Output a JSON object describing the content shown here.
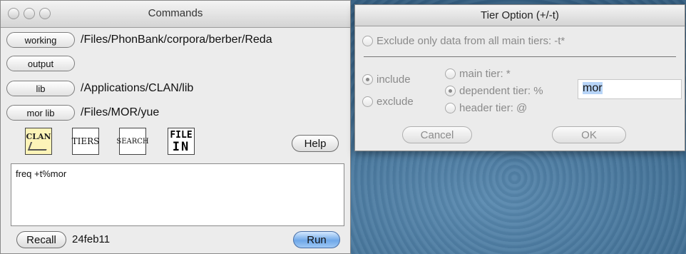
{
  "commands": {
    "title": "Commands",
    "working_label": "working",
    "working_path": "/Files/PhonBank/corpora/berber/Reda",
    "output_label": "output",
    "lib_label": "lib",
    "lib_path": "/Applications/CLAN/lib",
    "morlib_label": "mor lib",
    "morlib_path": "/Files/MOR/yue",
    "icons": {
      "clan": "CLAN",
      "tiers": "TIERS",
      "search": "SEARCH",
      "file_top": "FILE",
      "file_bottom": "IN"
    },
    "help_label": "Help",
    "command_text": "freq +t%mor",
    "recall_label": "Recall",
    "date": "24feb11",
    "run_label": "Run"
  },
  "tier_option": {
    "title": "Tier Option (+/-t)",
    "exclude_main": "Exclude only data from all main tiers: -t*",
    "include": "include",
    "exclude": "exclude",
    "main_tier": "main tier: *",
    "dependent_tier": "dependent tier: %",
    "header_tier": "header tier: @",
    "dependent_value": "mor",
    "cancel_label": "Cancel",
    "ok_label": "OK"
  }
}
